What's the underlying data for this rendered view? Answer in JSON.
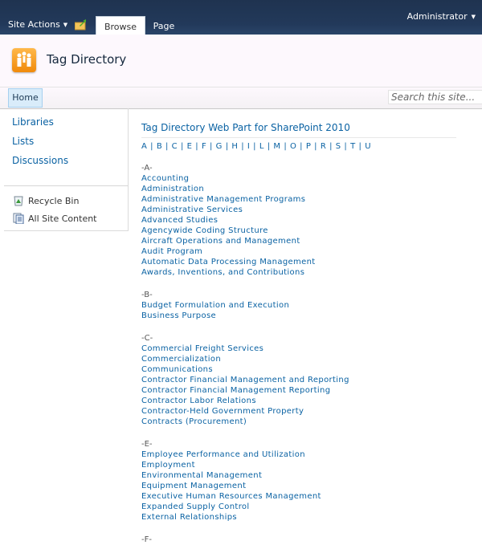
{
  "ribbon": {
    "site_actions": "Site Actions",
    "tabs": [
      "Browse",
      "Page"
    ],
    "user": "Administrator"
  },
  "site": {
    "title": "Tag Directory"
  },
  "topnav": {
    "home": "Home",
    "search_placeholder": "Search this site..."
  },
  "quicklaunch": {
    "items": [
      "Libraries",
      "Lists",
      "Discussions"
    ],
    "bottom_items": [
      "Recycle Bin",
      "All Site Content"
    ]
  },
  "webpart": {
    "title": "Tag Directory Web Part for SharePoint 2010",
    "letters": [
      "A",
      "B",
      "C",
      "E",
      "F",
      "G",
      "H",
      "I",
      "L",
      "M",
      "O",
      "P",
      "R",
      "S",
      "T",
      "U"
    ],
    "groups": [
      {
        "heading": "-A-",
        "items": [
          "Accounting",
          "Administration",
          "Administrative Management Programs",
          "Administrative Services",
          "Advanced Studies",
          "Agencywide Coding Structure",
          "Aircraft Operations and Management",
          "Audit Program",
          "Automatic Data Processing Management",
          "Awards, Inventions, and Contributions"
        ]
      },
      {
        "heading": "-B-",
        "items": [
          "Budget Formulation and Execution",
          "Business Purpose"
        ]
      },
      {
        "heading": "-C-",
        "items": [
          "Commercial Freight Services",
          "Commercialization",
          "Communications",
          "Contractor Financial Management and Reporting",
          "Contractor Financial Management Reporting",
          "Contractor Labor Relations",
          "Contractor-Held Government Property",
          "Contracts (Procurement)"
        ]
      },
      {
        "heading": "-E-",
        "items": [
          "Employee Performance and Utilization",
          "Employment",
          "Environmental Management",
          "Equipment Management",
          "Executive Human Resources Management",
          "Expanded Supply Control",
          "External Relationships"
        ]
      },
      {
        "heading": "-F-",
        "items": []
      }
    ]
  }
}
